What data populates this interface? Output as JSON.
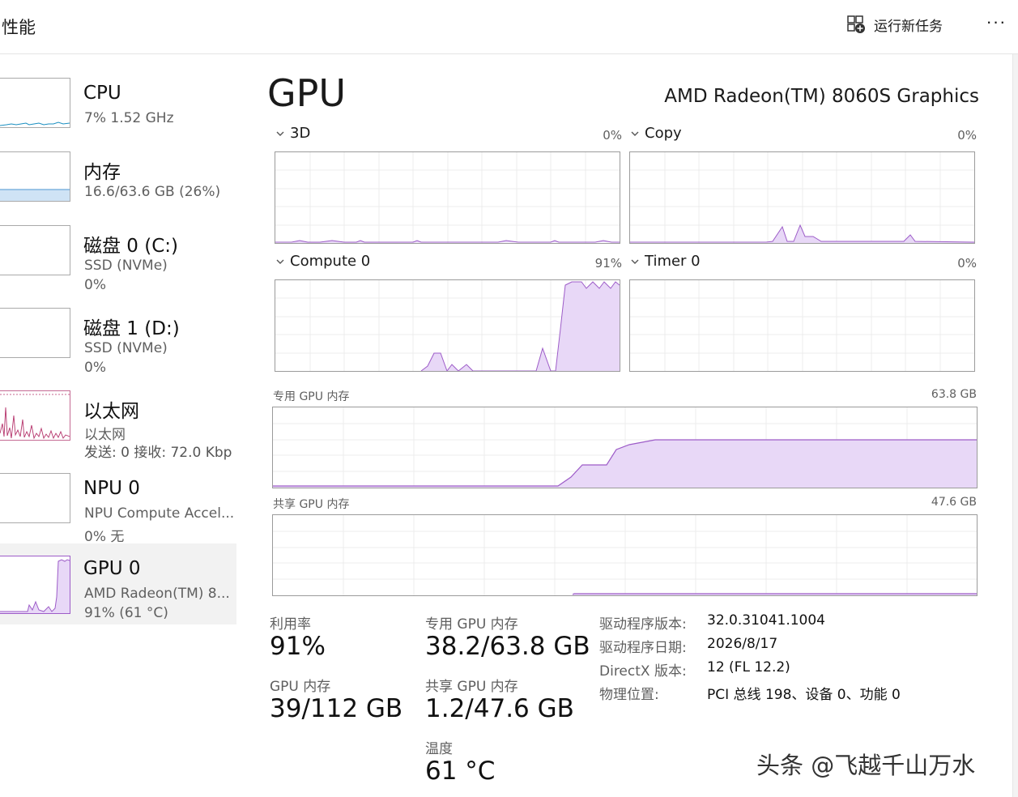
{
  "header": {
    "title": "性能",
    "run_task_label": "运行新任务",
    "more_label": "···"
  },
  "sidebar": {
    "items": [
      {
        "name": "CPU",
        "sub1": "7%  1.52 GHz",
        "sub2": ""
      },
      {
        "name": "内存",
        "sub1": "16.6/63.6 GB (26%)",
        "sub2": ""
      },
      {
        "name": "磁盘 0 (C:)",
        "sub1": "SSD (NVMe)",
        "sub2": "0%"
      },
      {
        "name": "磁盘 1 (D:)",
        "sub1": "SSD (NVMe)",
        "sub2": "0%"
      },
      {
        "name": "以太网",
        "sub1": "以太网",
        "sub2": "发送: 0 接收: 72.0 Kbp"
      },
      {
        "name": "NPU 0",
        "sub1": "NPU Compute Accel...",
        "sub2": "0%  无"
      },
      {
        "name": "GPU 0",
        "sub1": "AMD Radeon(TM) 8...",
        "sub2": "91%  (61 °C)"
      }
    ]
  },
  "main": {
    "title": "GPU",
    "model": "AMD Radeon(TM) 8060S Graphics",
    "engines": [
      {
        "name": "3D",
        "pct": "0%"
      },
      {
        "name": "Copy",
        "pct": "0%"
      },
      {
        "name": "Compute 0",
        "pct": "91%"
      },
      {
        "name": "Timer 0",
        "pct": "0%"
      }
    ],
    "dedicated_label": "专用 GPU 内存",
    "dedicated_max": "63.8 GB",
    "shared_label": "共享 GPU 内存",
    "shared_max": "47.6 GB",
    "stats": {
      "util_label": "利用率",
      "util_value": "91%",
      "gpu_mem_label": "GPU 内存",
      "gpu_mem_value": "39/112 GB",
      "ded_label": "专用 GPU 内存",
      "ded_value": "38.2/63.8 GB",
      "shared_label": "共享 GPU 内存",
      "shared_value": "1.2/47.6 GB",
      "temp_label": "温度",
      "temp_value": "61 °C"
    },
    "info": [
      {
        "key": "驱动程序版本:",
        "value": "32.0.31041.1004"
      },
      {
        "key": "驱动程序日期:",
        "value": "2026/8/17"
      },
      {
        "key": "DirectX 版本:",
        "value": "12 (FL 12.2)"
      },
      {
        "key": "物理位置:",
        "value": "PCI 总线 198、设备 0、功能 0"
      }
    ]
  },
  "watermark": "头条 @飞越千山万水",
  "colors": {
    "gpu": "#9d5cc8",
    "gpu_fill": "#e8d8f7",
    "cpu": "#1a8fc1",
    "mem": "#6aa7db",
    "mem_fill": "#cfe3f5",
    "net": "#b5336b",
    "grid": "#ececec"
  }
}
